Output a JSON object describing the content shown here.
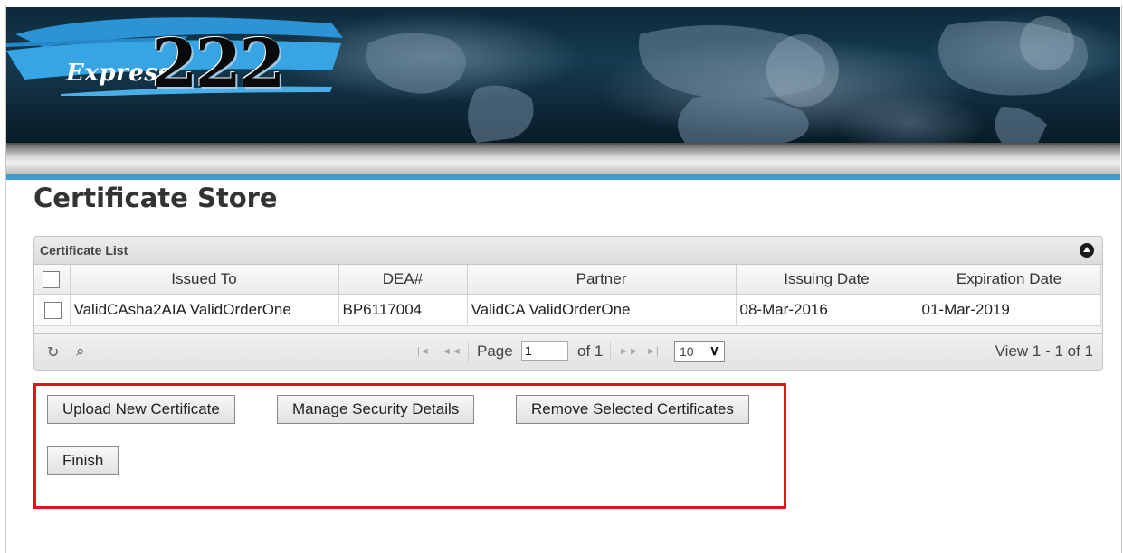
{
  "header": {
    "logo_word": "Express",
    "logo_number": "222"
  },
  "page": {
    "title": "Certificate Store"
  },
  "grid": {
    "caption": "Certificate List",
    "columns": [
      "Issued To",
      "DEA#",
      "Partner",
      "Issuing Date",
      "Expiration Date"
    ],
    "rows": [
      {
        "issued_to": "ValidCAsha2AIA ValidOrderOne",
        "dea": "BP6117004",
        "partner": "ValidCA ValidOrderOne",
        "issuing_date": "08-Mar-2016",
        "expiration_date": "01-Mar-2019",
        "selected": false
      }
    ],
    "pager": {
      "page_label": "Page",
      "page_value": "1",
      "of_label": "of 1",
      "rows_per_page": "10",
      "view_info": "View 1 - 1 of 1"
    }
  },
  "actions": {
    "upload_label": "Upload New Certificate",
    "manage_label": "Manage Security Details",
    "remove_label": "Remove Selected Certificates",
    "finish_label": "Finish"
  },
  "colors": {
    "accent_blue": "#3f9bd0",
    "highlight_red": "#e3141b"
  }
}
